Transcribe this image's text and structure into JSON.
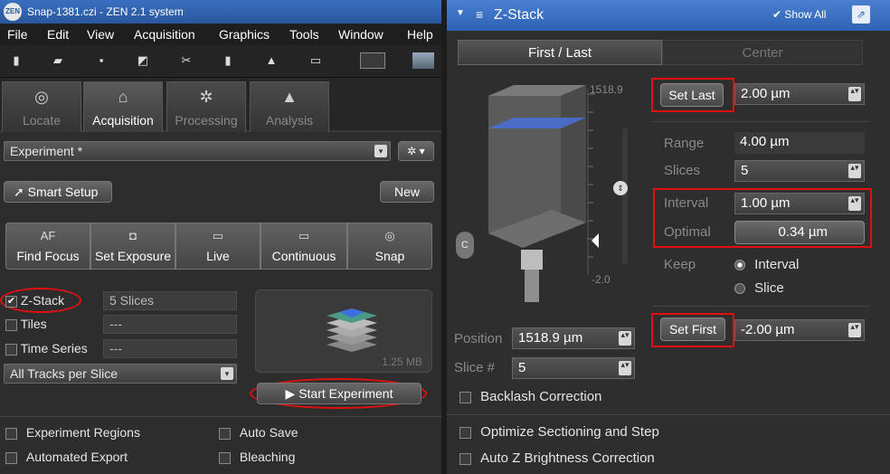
{
  "window": {
    "title": "Snap-1381.czi - ZEN 2.1 system",
    "logo": "ZEN"
  },
  "menu": [
    "File",
    "Edit",
    "View",
    "Acquisition",
    "Graphics",
    "Tools",
    "Window",
    "Help"
  ],
  "toolbar_icons": [
    "pin-icon",
    "open-folder-icon",
    "save-icon",
    "zoom-icon",
    "cut-icon",
    "bookmark-icon",
    "arrow-up-icon",
    "scale-bar-icon",
    "image-frame-icon",
    "landscape-icon"
  ],
  "main_tabs": [
    {
      "label": "Locate",
      "icon": "eye-icon",
      "active": false
    },
    {
      "label": "Acquisition",
      "icon": "microscope-icon",
      "active": true
    },
    {
      "label": "Processing",
      "icon": "gear-icon",
      "active": false
    },
    {
      "label": "Analysis",
      "icon": "flask-icon",
      "active": false
    }
  ],
  "experiment": {
    "value": "Experiment *",
    "gear_label": "✲ ▾"
  },
  "smart_setup": {
    "label": "Smart Setup",
    "new_label": "New"
  },
  "acq_buttons": [
    {
      "icon_text": "AF",
      "label": "Find Focus"
    },
    {
      "icon_text": "◘",
      "label": "Set Exposure"
    },
    {
      "icon_text": "▭",
      "label": "Live"
    },
    {
      "icon_text": "▭",
      "label": "Continuous"
    },
    {
      "icon_text": "◎",
      "label": "Snap"
    }
  ],
  "dimensions": [
    {
      "label": "Z-Stack",
      "checked": true,
      "value": "5 Slices"
    },
    {
      "label": "Tiles",
      "checked": false,
      "value": "---"
    },
    {
      "label": "Time Series",
      "checked": false,
      "value": "---"
    }
  ],
  "tracks": {
    "value": "All Tracks per Slice"
  },
  "preview": {
    "size": "1.25 MB"
  },
  "start_experiment": {
    "label": "Start Experiment"
  },
  "bottom_checks": [
    {
      "label": "Experiment Regions"
    },
    {
      "label": "Auto Save"
    },
    {
      "label": "Automated Export"
    },
    {
      "label": "Bleaching"
    }
  ],
  "zstack_panel": {
    "title": "Z-Stack",
    "show_all": "Show All",
    "modes": [
      "First / Last",
      "Center"
    ],
    "active_mode": "First / Last",
    "scale_top": "1518.9",
    "scale_bottom": "-2.0",
    "set_last": {
      "label": "Set Last",
      "value": "2.00 µm"
    },
    "range": {
      "label": "Range",
      "value": "4.00 µm"
    },
    "slices": {
      "label": "Slices",
      "value": "5"
    },
    "interval": {
      "label": "Interval",
      "value": "1.00 µm"
    },
    "optimal": {
      "label": "Optimal",
      "value": "0.34 µm"
    },
    "keep": {
      "label": "Keep",
      "options": [
        "Interval",
        "Slice"
      ],
      "selected": "Interval"
    },
    "set_first": {
      "label": "Set First",
      "value": "-2.00 µm"
    },
    "position": {
      "label": "Position",
      "value": "1518.9 µm"
    },
    "slice_no": {
      "label": "Slice #",
      "value": "5"
    },
    "backlash": "Backlash Correction",
    "optimize": "Optimize Sectioning and Step",
    "auto_z": "Auto Z Brightness Correction"
  },
  "colors": {
    "title_blue": "#2e62b5",
    "highlight_red": "#e01010",
    "focus_plane": "#3d6fe0"
  }
}
